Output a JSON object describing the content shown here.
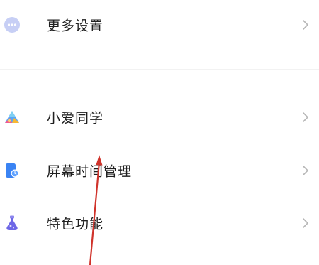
{
  "settings": {
    "items": [
      {
        "label": "更多设置",
        "icon": "more-dots-icon",
        "chevron": "chevron-right-icon"
      },
      {
        "label": "小爱同学",
        "icon": "xiaoai-icon",
        "chevron": "chevron-right-icon"
      },
      {
        "label": "屏幕时间管理",
        "icon": "screen-time-icon",
        "chevron": "chevron-right-icon"
      },
      {
        "label": "特色功能",
        "icon": "flask-icon",
        "chevron": "chevron-right-icon"
      }
    ]
  },
  "colors": {
    "more_icon": "#c7cff5",
    "screen_time_icon": "#3a83f3",
    "flask_icon": "#6e67e6",
    "annotation_arrow": "#d0332b",
    "chevron": "#b6b6b6"
  }
}
